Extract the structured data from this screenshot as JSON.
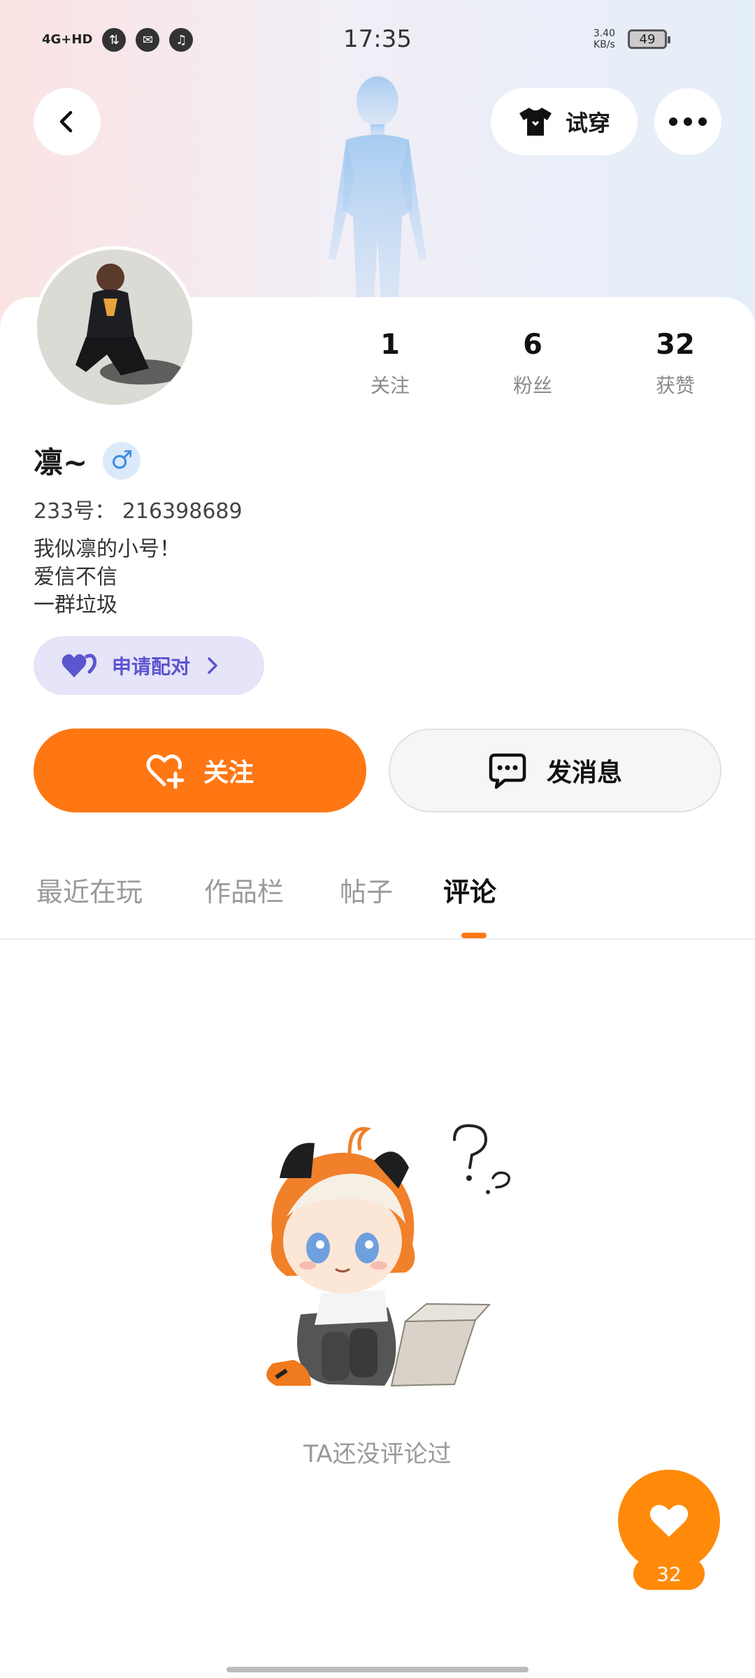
{
  "status_bar": {
    "network": "4G+HD",
    "time": "17:35",
    "speed_value": "3.40",
    "speed_unit": "KB/s",
    "battery": "49"
  },
  "header": {
    "tryon_label": "试穿"
  },
  "profile": {
    "name": "凛~",
    "gender_symbol": "♂",
    "uid": "233号： 216398689",
    "bio": [
      "我似凛的小号！",
      "爱信不信",
      "一群垃圾"
    ]
  },
  "stats": [
    {
      "value": "1",
      "label": "关注"
    },
    {
      "value": "6",
      "label": "粉丝"
    },
    {
      "value": "32",
      "label": "获赞"
    }
  ],
  "pair_button": {
    "label": "申请配对"
  },
  "actions": {
    "follow_label": "关注",
    "message_label": "发消息"
  },
  "tabs": [
    {
      "label": "最近在玩",
      "active": false
    },
    {
      "label": "作品栏",
      "active": false
    },
    {
      "label": "帖子",
      "active": false
    },
    {
      "label": "评论",
      "active": true
    }
  ],
  "empty_state": {
    "text": "TA还没评论过"
  },
  "like_fab": {
    "count": "32"
  },
  "colors": {
    "accent": "#ff7713",
    "pair_bg": "#e6e4f8",
    "pair_text": "#5b55d0",
    "gender": "#3f8de6"
  }
}
